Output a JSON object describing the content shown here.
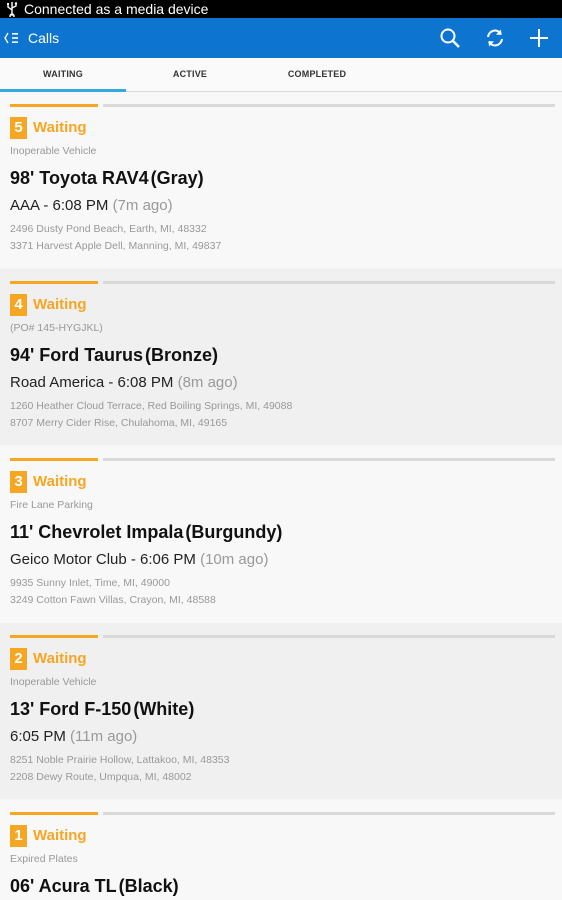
{
  "status_bar": {
    "text": "Connected as a media device",
    "icon": "usb-icon"
  },
  "action_bar": {
    "title": "Calls",
    "bg_color": "#0d74cf",
    "icons": [
      "back-icon",
      "search-icon",
      "refresh-icon",
      "add-icon"
    ]
  },
  "tabs": [
    {
      "label": "WAITING",
      "active": true
    },
    {
      "label": "ACTIVE",
      "active": false
    },
    {
      "label": "COMPLETED",
      "active": false
    }
  ],
  "accent_color": "#f5a623",
  "calls": [
    {
      "number": "5",
      "status": "Waiting",
      "subtitle": "Inoperable Vehicle",
      "vehicle": "98' Toyota RAV4",
      "color": "(Gray)",
      "caller": "AAA - 6:08 PM",
      "ago": "(7m ago)",
      "addr1": "2496 Dusty Pond Beach, Earth, MI, 48332",
      "addr2": "3371 Harvest Apple Dell, Manning, MI, 49837"
    },
    {
      "number": "4",
      "status": "Waiting",
      "subtitle": "(PO# 145-HYGJKL)",
      "vehicle": "94' Ford Taurus",
      "color": "(Bronze)",
      "caller": "Road America - 6:08 PM",
      "ago": "(8m ago)",
      "addr1": "1260 Heather Cloud Terrace, Red Boiling Springs, MI, 49088",
      "addr2": "8707 Merry Cider Rise, Chulahoma, MI, 49165"
    },
    {
      "number": "3",
      "status": "Waiting",
      "subtitle": "Fire Lane Parking",
      "vehicle": "11' Chevrolet Impala",
      "color": "(Burgundy)",
      "caller": "Geico Motor Club - 6:06 PM",
      "ago": "(10m ago)",
      "addr1": "9935 Sunny Inlet, Time, MI, 49000",
      "addr2": "3249 Cotton Fawn Villas, Crayon, MI, 48588"
    },
    {
      "number": "2",
      "status": "Waiting",
      "subtitle": "Inoperable Vehicle",
      "vehicle": "13' Ford F-150",
      "color": "(White)",
      "caller": "6:05 PM",
      "ago": "(11m ago)",
      "addr1": "8251 Noble Prairie Hollow, Lattakoo, MI, 48353",
      "addr2": "2208 Dewy Route, Umpqua, MI, 48002"
    },
    {
      "number": "1",
      "status": "Waiting",
      "subtitle": "Expired Plates",
      "vehicle": "06' Acura TL",
      "color": "(Black)",
      "caller": "",
      "ago": "",
      "addr1": "",
      "addr2": ""
    }
  ]
}
